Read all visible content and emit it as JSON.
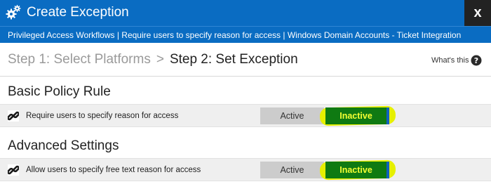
{
  "window": {
    "title": "Create Exception",
    "close_label": "x",
    "subtitle": "Privileged Access Workflows | Require users to specify reason for access | Windows Domain Accounts - Ticket Integration"
  },
  "steps": {
    "step1": "Step 1: Select Platforms",
    "separator": ">",
    "step2": "Step 2: Set Exception",
    "whats_this": "What's this"
  },
  "sections": [
    {
      "heading": "Basic Policy Rule",
      "rule_label": "Require users to specify reason for access",
      "active_label": "Active",
      "inactive_label": "Inactive",
      "selected": "Inactive"
    },
    {
      "heading": "Advanced Settings",
      "rule_label": "Allow users to specify free text reason for access",
      "active_label": "Active",
      "inactive_label": "Inactive",
      "selected": "Inactive"
    }
  ],
  "colors": {
    "header_blue": "#0a6cc2",
    "close_bg": "#222222",
    "inactive_bg": "#0f7a12",
    "inactive_text": "#f4ff33",
    "highlight": "#e6f000"
  },
  "icons": {
    "title": "gears-icon",
    "help": "help-icon",
    "rule": "link-icon"
  }
}
